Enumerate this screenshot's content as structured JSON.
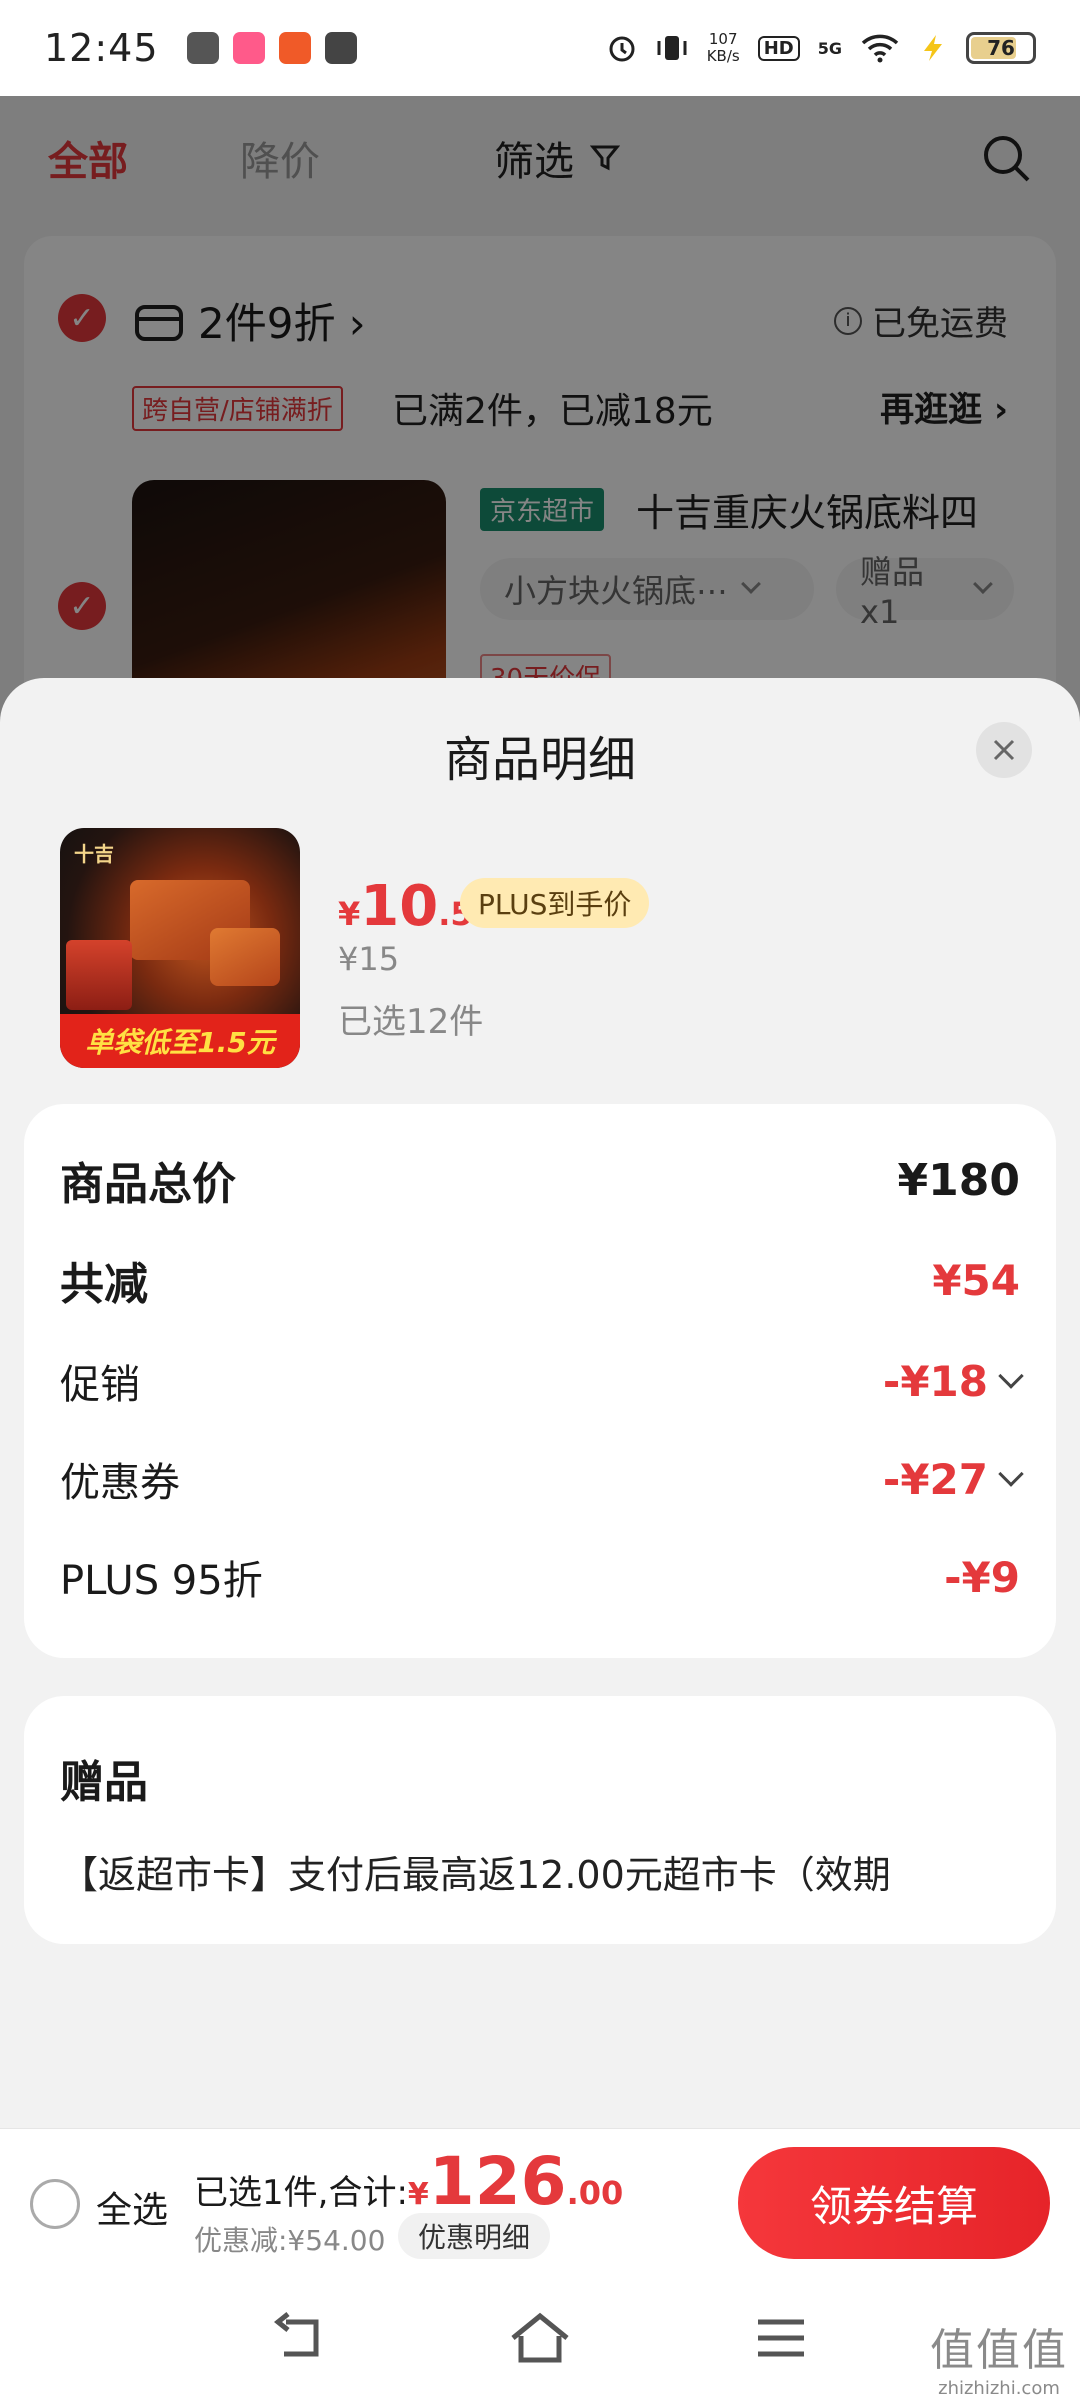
{
  "status_bar": {
    "time": "12:45",
    "net_speed": "107",
    "net_unit": "KB/s",
    "hd": "HD",
    "signal": "5G",
    "battery": "76"
  },
  "cart": {
    "tabs": {
      "all": "全部",
      "price_drop": "降价",
      "filter": "筛选"
    },
    "promo_title": "2件9折 ›",
    "free_shipping": "已免运费",
    "promo_tag": "跨自营/店铺满折",
    "promo_desc": "已满2件，已减18元",
    "promo_more": "再逛逛 ›",
    "store_tag": "京东超市",
    "product_title": "十吉重庆火锅底料四",
    "spec_select": "小方块火锅底⋯",
    "gift_select": "赠品x1",
    "price_protect": "30天价保"
  },
  "sheet": {
    "title": "商品明细",
    "item": {
      "logo": "十吉",
      "banner": "单袋低至1.5元",
      "price_symbol": "¥",
      "price_int": "10",
      "price_dec": ".5",
      "plus_badge": "PLUS到手价",
      "original_price": "¥15",
      "selected_count": "已选12件"
    },
    "price_breakdown": {
      "total_label": "商品总价",
      "total_value": "¥180",
      "reduced_label": "共减",
      "reduced_value": "¥54",
      "promo_label": "促销",
      "promo_value": "-¥18",
      "coupon_label": "优惠券",
      "coupon_value": "-¥27",
      "plus_label": "PLUS 95折",
      "plus_value": "-¥9"
    },
    "gift": {
      "title": "赠品",
      "text": "【返超市卡】支付后最高返12.00元超市卡（效期"
    }
  },
  "checkout": {
    "select_all": "全选",
    "summary": "已选1件,合计:",
    "currency": "¥",
    "total_int": "126",
    "total_dec": ".00",
    "discount": "优惠减:¥54.00",
    "detail_button": "优惠明细",
    "pay_button": "领券结算"
  },
  "watermark": {
    "glyphs": "值值值",
    "domain": "zhizhizhi.com"
  },
  "colors": {
    "accent_red": "#e4393c",
    "jd_green": "#1a8f6d",
    "plus_gold": "#ffeab2"
  }
}
